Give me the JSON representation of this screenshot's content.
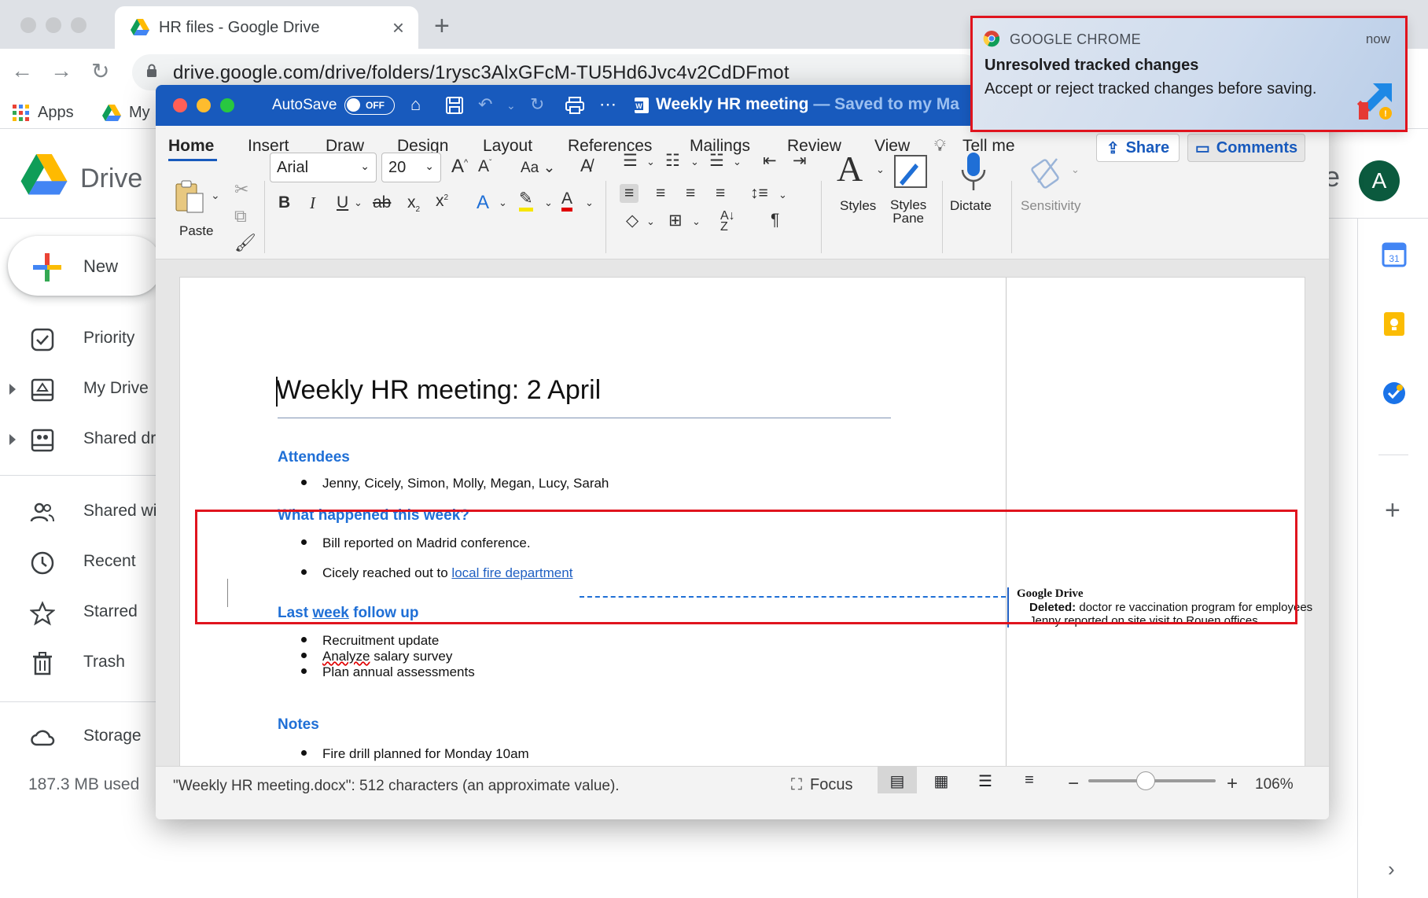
{
  "browser": {
    "tab_title": "HR files - Google Drive",
    "url": "drive.google.com/drive/folders/1rysc3AlxGFcM-TU5Hd6Jvc4v2CdDFmot",
    "bookmarks": [
      {
        "label": "Apps",
        "icon": "apps-grid-icon"
      },
      {
        "label": "My",
        "icon": "drive-icon"
      }
    ]
  },
  "drive": {
    "app_name": "Drive",
    "search_tail": "e",
    "avatar_initial": "A",
    "new_label": "New",
    "nav": [
      {
        "label": "Priority",
        "icon": "priority-check-icon"
      },
      {
        "label": "My Drive",
        "icon": "my-drive-icon"
      },
      {
        "label": "Shared dr",
        "icon": "shared-drives-icon"
      },
      {
        "label": "Shared wi",
        "icon": "shared-with-me-icon"
      },
      {
        "label": "Recent",
        "icon": "clock-icon"
      },
      {
        "label": "Starred",
        "icon": "star-icon"
      },
      {
        "label": "Trash",
        "icon": "trash-icon"
      },
      {
        "label": "Storage",
        "icon": "cloud-icon"
      }
    ],
    "storage_used": "187.3 MB used",
    "right_rail": [
      "calendar-icon",
      "keep-icon",
      "tasks-icon",
      "add-icon"
    ]
  },
  "word": {
    "autosave_label": "AutoSave",
    "autosave_state": "OFF",
    "doc_name": "Weekly HR meeting",
    "save_status": " — Saved to my Ma",
    "tabs": [
      "Home",
      "Insert",
      "Draw",
      "Design",
      "Layout",
      "References",
      "Mailings",
      "Review",
      "View"
    ],
    "tell_me": "Tell me",
    "share_label": "Share",
    "comments_label": "Comments",
    "ribbon": {
      "paste": "Paste",
      "font_name": "Arial",
      "font_size": "20",
      "styles": "Styles",
      "styles_pane": [
        "Styles",
        "Pane"
      ],
      "dictate": "Dictate",
      "sensitivity": "Sensitivity"
    },
    "document": {
      "title": "Weekly HR meeting: 2 April",
      "attendees_heading": "Attendees",
      "attendees": [
        "Jenny, Cicely, Simon, Molly, Megan, Lucy, Sarah"
      ],
      "week_heading": "What happened this week?",
      "week_item1": "Bill reported on Madrid conference.",
      "week_item2_prefix": "Cicely reached out to ",
      "week_item2_link": "local fire department",
      "last_week_heading_a": "Last ",
      "last_week_heading_b": "week",
      "last_week_heading_c": " follow up",
      "last_week_items": [
        "Recruitment update",
        "Plan annual assessments"
      ],
      "last_week_misspelled": "Analyze",
      "last_week_item2_rest": " salary survey",
      "notes_heading": "Notes",
      "notes": [
        "Fire drill planned for Monday 10am"
      ]
    },
    "balloon": {
      "author": "Google Drive",
      "deleted_label": "Deleted:",
      "deleted_text": " doctor re vaccination program for employees",
      "line2": "Jenny reported on site visit to Rouen offices"
    },
    "status": {
      "text": "\"Weekly HR meeting.docx\": 512 characters (an approximate value).",
      "focus": "Focus",
      "zoom": "106%",
      "zoom_fraction": 0.45
    }
  },
  "notification": {
    "app": "GOOGLE CHROME",
    "time": "now",
    "title": "Unresolved tracked changes",
    "body": "Accept or reject tracked changes before saving."
  },
  "colors": {
    "word_blue": "#185abd",
    "heading_blue": "#1f6fd6",
    "highlight_red": "#e0141e"
  }
}
